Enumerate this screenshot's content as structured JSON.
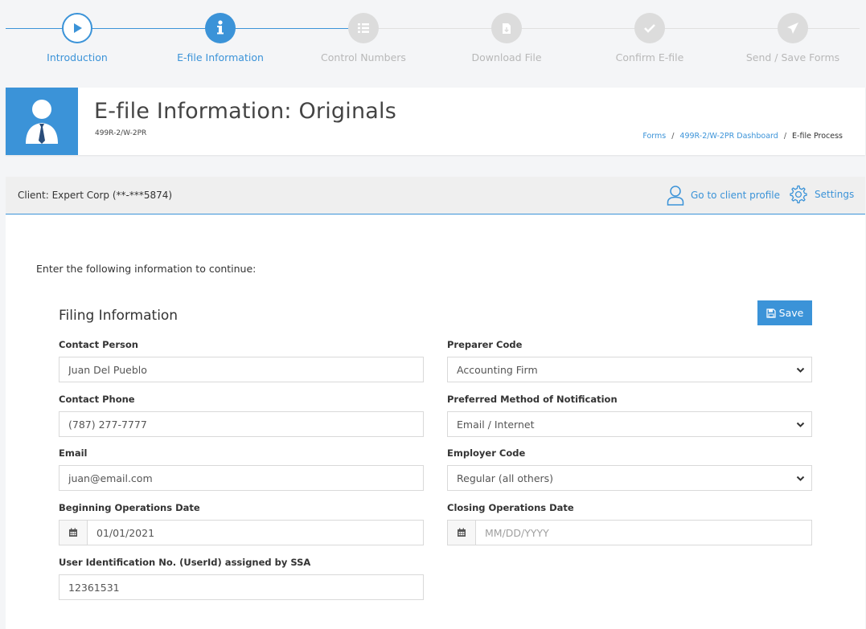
{
  "stepper": {
    "steps": [
      {
        "label": "Introduction",
        "state": "done",
        "icon": "play-icon"
      },
      {
        "label": "E-file Information",
        "state": "active",
        "icon": "info-icon"
      },
      {
        "label": "Control Numbers",
        "state": "future",
        "icon": "list-icon"
      },
      {
        "label": "Download File",
        "state": "future",
        "icon": "download-file-icon"
      },
      {
        "label": "Confirm E-file",
        "state": "future",
        "icon": "check-icon"
      },
      {
        "label": "Send / Save Forms",
        "state": "future",
        "icon": "paper-plane-icon"
      }
    ]
  },
  "header": {
    "title": "E-file Information: Originals",
    "subtitle": "499R-2/W-2PR",
    "breadcrumb": [
      "Forms",
      "499R-2/W-2PR Dashboard",
      "E-file Process"
    ]
  },
  "client_bar": {
    "client_label": "Client: Expert Corp (**-***5874)",
    "profile_link": "Go to client profile",
    "settings_link": "Settings"
  },
  "form": {
    "intro": "Enter the following information to continue:",
    "section_title": "Filing Information",
    "save_label": "Save",
    "contact_person": {
      "label": "Contact Person",
      "value": "Juan Del Pueblo"
    },
    "contact_phone": {
      "label": "Contact Phone",
      "value": "(787) 277-7777"
    },
    "email": {
      "label": "Email",
      "value": "juan@email.com"
    },
    "begin_date": {
      "label": "Beginning Operations Date",
      "value": "01/01/2021"
    },
    "user_id": {
      "label": "User Identification No. (UserId) assigned by SSA",
      "value": "12361531"
    },
    "preparer_code": {
      "label": "Preparer Code",
      "value": "Accounting Firm"
    },
    "notification": {
      "label": "Preferred Method of Notification",
      "value": "Email / Internet"
    },
    "employer_code": {
      "label": "Employer Code",
      "value": "Regular (all others)"
    },
    "closing_date": {
      "label": "Closing Operations Date",
      "value": "",
      "placeholder": "MM/DD/YYYY"
    }
  },
  "colors": {
    "accent": "#3b93d8",
    "inactive": "#dcdcdc"
  }
}
